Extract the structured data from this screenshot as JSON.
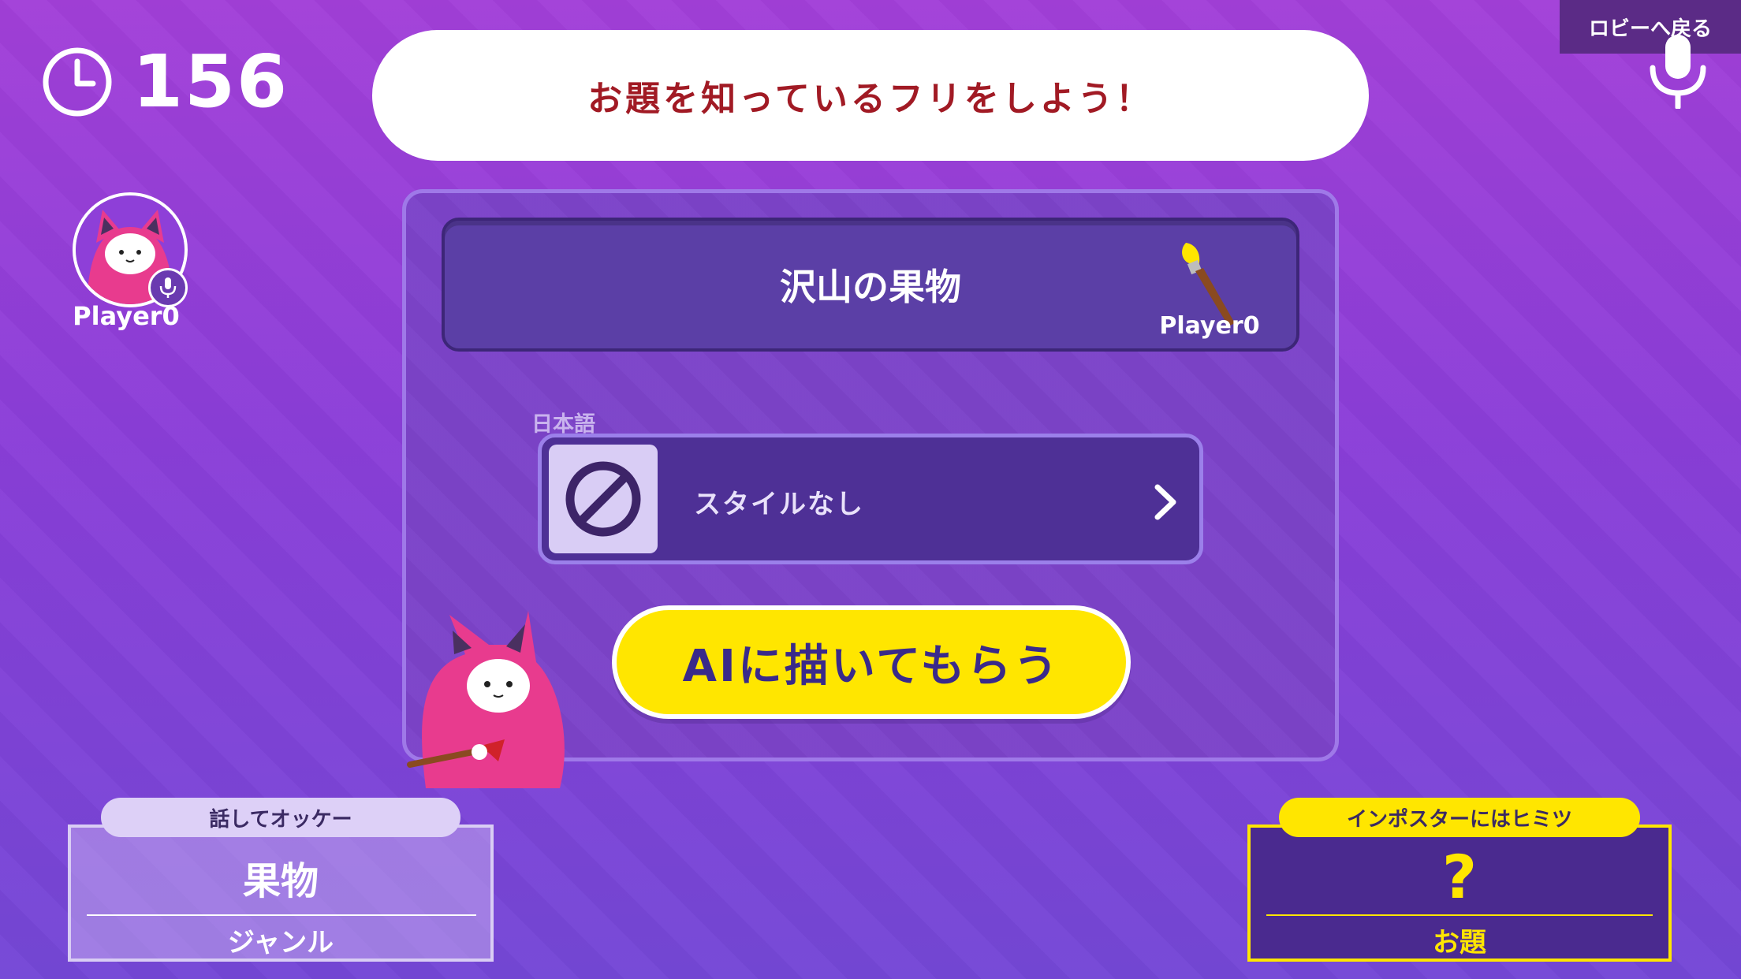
{
  "timer": {
    "value": "156"
  },
  "banner": {
    "text": "お題を知っているフリをしよう！"
  },
  "lobby": {
    "label": "ロビーへ戻る"
  },
  "player": {
    "name": "Player0"
  },
  "topic": {
    "text": "沢山の果物",
    "drawer": "Player0"
  },
  "style": {
    "language_label": "日本語",
    "selected": "スタイルなし"
  },
  "ai_button": {
    "label": "AIに描いてもらう"
  },
  "genre_card": {
    "tag": "話してオッケー",
    "value": "果物",
    "label": "ジャンル"
  },
  "topic_card": {
    "tag": "インポスターにはヒミツ",
    "value": "?",
    "label": "お題"
  },
  "colors": {
    "accent_yellow": "#ffe600",
    "banner_red": "#a11a24",
    "mascot_pink": "#e83b8e"
  },
  "icons": [
    "clock-icon",
    "microphone-icon",
    "brush-icon",
    "no-style-icon",
    "chevron-right-icon"
  ]
}
